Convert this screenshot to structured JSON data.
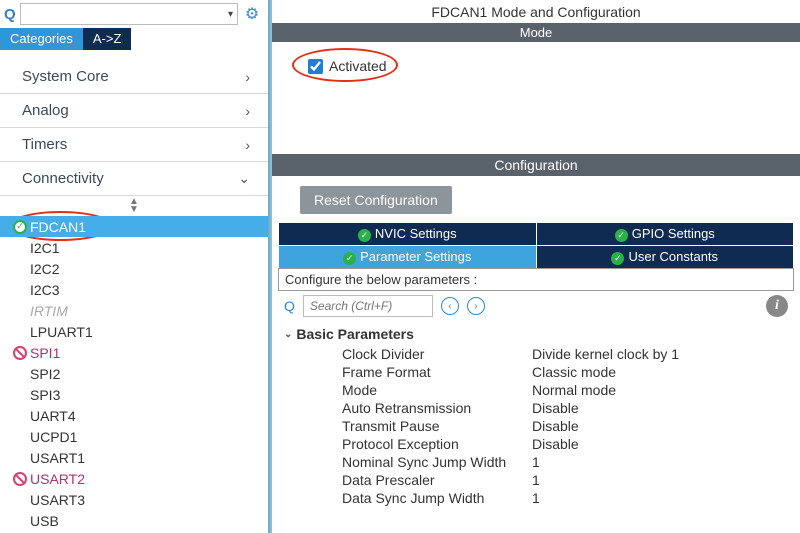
{
  "search": {
    "placeholder": ""
  },
  "tabs": {
    "categories": "Categories",
    "az": "A->Z"
  },
  "nav_groups": [
    {
      "label": "System Core",
      "expanded": false
    },
    {
      "label": "Analog",
      "expanded": false
    },
    {
      "label": "Timers",
      "expanded": false
    },
    {
      "label": "Connectivity",
      "expanded": true
    }
  ],
  "peripherals": [
    {
      "label": "FDCAN1",
      "status": "ok",
      "selected": true
    },
    {
      "label": "I2C1",
      "status": ""
    },
    {
      "label": "I2C2",
      "status": ""
    },
    {
      "label": "I2C3",
      "status": ""
    },
    {
      "label": "IRTIM",
      "status": "dim"
    },
    {
      "label": "LPUART1",
      "status": ""
    },
    {
      "label": "SPI1",
      "status": "blocked"
    },
    {
      "label": "SPI2",
      "status": ""
    },
    {
      "label": "SPI3",
      "status": ""
    },
    {
      "label": "UART4",
      "status": ""
    },
    {
      "label": "UCPD1",
      "status": ""
    },
    {
      "label": "USART1",
      "status": ""
    },
    {
      "label": "USART2",
      "status": "blocked"
    },
    {
      "label": "USART3",
      "status": ""
    },
    {
      "label": "USB",
      "status": ""
    }
  ],
  "right": {
    "title": "FDCAN1 Mode and Configuration",
    "mode_header": "Mode",
    "activated_label": "Activated",
    "activated_checked": true,
    "config_header": "Configuration",
    "reset_button": "Reset Configuration",
    "subtabs": {
      "nvic": "NVIC Settings",
      "gpio": "GPIO Settings",
      "param": "Parameter Settings",
      "user": "User Constants"
    },
    "param_heading": "Configure the below parameters :",
    "filter_placeholder": "Search (Ctrl+F)",
    "group_label": "Basic Parameters",
    "params": [
      {
        "label": "Clock Divider",
        "value": "Divide kernel clock by 1"
      },
      {
        "label": "Frame Format",
        "value": "Classic mode"
      },
      {
        "label": "Mode",
        "value": "Normal mode"
      },
      {
        "label": "Auto Retransmission",
        "value": "Disable"
      },
      {
        "label": "Transmit Pause",
        "value": "Disable"
      },
      {
        "label": "Protocol Exception",
        "value": "Disable"
      },
      {
        "label": "Nominal Sync Jump Width",
        "value": "1"
      },
      {
        "label": "Data Prescaler",
        "value": "1"
      },
      {
        "label": "Data Sync Jump Width",
        "value": "1"
      }
    ]
  }
}
